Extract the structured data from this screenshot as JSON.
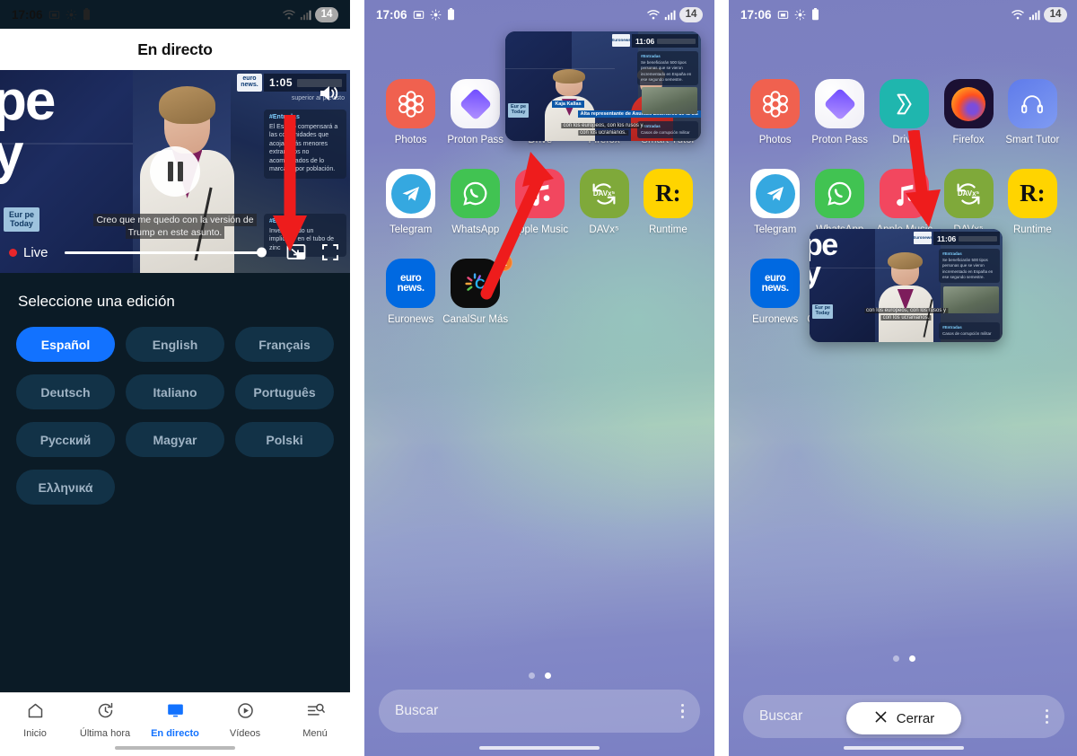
{
  "meta": {
    "accent_blue": "#1272ff",
    "annotation_red": "#ee1c1c",
    "panel1_bg": "#0b1b26"
  },
  "status_bar": {
    "time": "17:06",
    "battery_label": "14",
    "icons": [
      "screenshot-icon",
      "brightness-icon",
      "battery-icon",
      "wifi-icon",
      "signal-icon"
    ]
  },
  "panel1": {
    "header_title": "En directo",
    "player": {
      "channel_logo": "euro news.",
      "clock": "1:05",
      "live_label": "Live",
      "subtitle_line1": "Creo que me quedo con la versión de",
      "subtitle_line2": "Trump en este asunto.",
      "background_text_line1": "pe",
      "background_text_line2": "y",
      "overlay_badge_line1": "Eur  pe",
      "overlay_badge_line2": "Today",
      "news_card_head": "#Entradas",
      "news_card_body": "El Estado compensará a las comunidades que acojan más menores extranjeros no acompañados de lo marcado por población.",
      "news_card2_head": "#Entradas",
      "news_card2_body": "Investigando un implicado en el tubo de zinc",
      "top_caption": "superior al previsto",
      "controls": [
        "pause-button",
        "volume-icon",
        "picture-in-picture-icon",
        "fullscreen-icon",
        "seek-slider"
      ]
    },
    "edition": {
      "title": "Seleccione una edición",
      "languages": [
        {
          "label": "Español",
          "selected": true
        },
        {
          "label": "English",
          "selected": false
        },
        {
          "label": "Français",
          "selected": false
        },
        {
          "label": "Deutsch",
          "selected": false
        },
        {
          "label": "Italiano",
          "selected": false
        },
        {
          "label": "Português",
          "selected": false
        },
        {
          "label": "Русский",
          "selected": false
        },
        {
          "label": "Magyar",
          "selected": false
        },
        {
          "label": "Polski",
          "selected": false
        },
        {
          "label": "Ελληνικά",
          "selected": false
        }
      ]
    },
    "tabs": [
      {
        "label": "Inicio",
        "icon": "home-icon",
        "active": false
      },
      {
        "label": "Última hora",
        "icon": "refresh-clock-icon",
        "active": false
      },
      {
        "label": "En directo",
        "icon": "monitor-icon",
        "active": true
      },
      {
        "label": "Vídeos",
        "icon": "play-circle-icon",
        "active": false
      },
      {
        "label": "Menú",
        "icon": "menu-search-icon",
        "active": false
      }
    ]
  },
  "home": {
    "apps": [
      {
        "label": "Photos",
        "icon": "photos-icon"
      },
      {
        "label": "Proton Pass",
        "icon": "proton-pass-icon"
      },
      {
        "label": "Drive",
        "icon": "drive-icon"
      },
      {
        "label": "Firefox",
        "icon": "firefox-icon"
      },
      {
        "label": "Smart Tutor",
        "icon": "smart-tutor-icon"
      },
      {
        "label": "Telegram",
        "icon": "telegram-icon"
      },
      {
        "label": "WhatsApp",
        "icon": "whatsapp-icon"
      },
      {
        "label": "Apple Music",
        "icon": "apple-music-icon"
      },
      {
        "label": "DAVx⁵",
        "icon": "davx-icon"
      },
      {
        "label": "Runtime",
        "icon": "runtime-icon"
      },
      {
        "label": "Euronews",
        "icon": "euronews-icon"
      },
      {
        "label": "CanalSur Más",
        "icon": "canalsur-icon",
        "badge": "1"
      }
    ],
    "euronews_logo_line1": "euro",
    "euronews_logo_line2": "news.",
    "search_placeholder": "Buscar",
    "page_dots": {
      "count": 2,
      "active_index": 1
    },
    "close_button": {
      "label": "Cerrar",
      "icon": "close-x-icon"
    }
  },
  "pip": {
    "clock": "11:06",
    "station_label": "euronews",
    "caption_line1": "con los europeos, con los rusos y",
    "caption_line2": "con los ucranianos.",
    "speaker_name": "Kaja Kallas",
    "speaker_role": "Alta representante de Asuntos Exteriores de la UE",
    "second_speaker": "Kaja Kallas",
    "card_head": "#Entradas",
    "card_body": "Se beneficiarán 500 tipos personas que se vieron incrementado en España en ese segundo semestre.",
    "card2_head": "#Entradas",
    "card2_body": "Casos de corrupción militar",
    "bigtext_line1": "pe",
    "bigtext_line2": "y",
    "badge_line1": "Eur  pe",
    "badge_line2": "Today",
    "time_label": "Euronews"
  }
}
